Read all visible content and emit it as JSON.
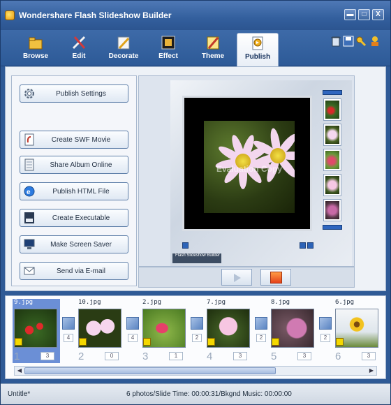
{
  "window": {
    "title": "Wondershare  Flash Slideshow Builder",
    "controls": {
      "minimize": "▬",
      "maximize": "□",
      "close": "X"
    }
  },
  "tabs": [
    {
      "label": "Browse",
      "icon": "browse-icon",
      "active": false
    },
    {
      "label": "Edit",
      "icon": "edit-icon",
      "active": false
    },
    {
      "label": "Decorate",
      "icon": "decorate-icon",
      "active": false
    },
    {
      "label": "Effect",
      "icon": "effect-icon",
      "active": false
    },
    {
      "label": "Theme",
      "icon": "theme-icon",
      "active": false
    },
    {
      "label": "Publish",
      "icon": "publish-icon",
      "active": true
    }
  ],
  "publish_panel": {
    "settings": "Publish Settings",
    "create_swf": "Create SWF Movie",
    "share_album": "Share Album Online",
    "publish_html": "Publish HTML File",
    "create_exe": "Create Executable",
    "screensaver": "Make Screen Saver",
    "email": "Send via E-mail"
  },
  "preview": {
    "watermark": "Evaluation Copy",
    "brand": "Flash Slideshow Builder"
  },
  "storyboard": {
    "slides": [
      {
        "file": "9.jpg",
        "index": "1",
        "duration": "3",
        "transition": "4",
        "selected": true
      },
      {
        "file": "10.jpg",
        "index": "2",
        "duration": "0",
        "transition": "4",
        "selected": false
      },
      {
        "file": "2.jpg",
        "index": "3",
        "duration": "1",
        "transition": "2",
        "selected": false
      },
      {
        "file": "7.jpg",
        "index": "4",
        "duration": "3",
        "transition": "2",
        "selected": false
      },
      {
        "file": "8.jpg",
        "index": "5",
        "duration": "3",
        "transition": "2",
        "selected": false
      },
      {
        "file": "6.jpg",
        "index": "6",
        "duration": "3",
        "transition": "",
        "selected": false
      }
    ]
  },
  "status": {
    "doc": "Untitle*",
    "summary": "6 photos/Slide Time: 00:00:31/Bkgnd Music: 00:00:00"
  },
  "colors": {
    "titlebar": "#335f9d",
    "accent": "#2c63b7",
    "selected_slide": "#6b8fd6"
  }
}
